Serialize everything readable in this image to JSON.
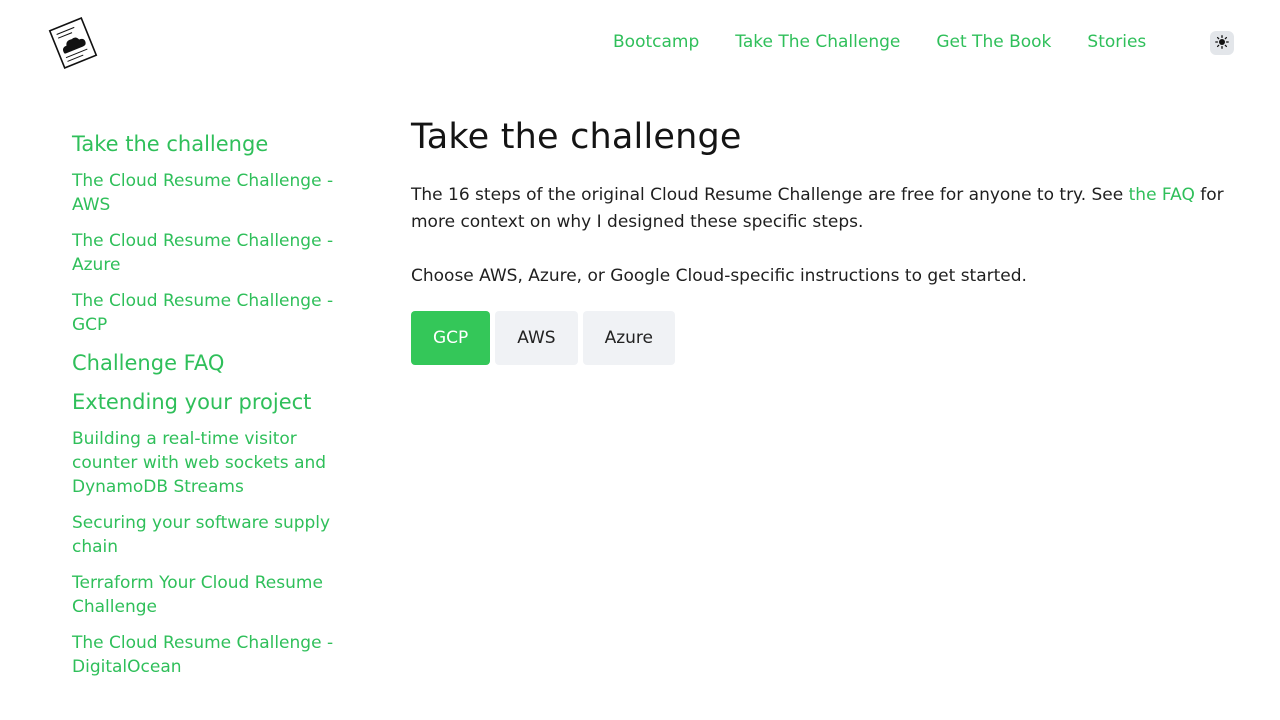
{
  "header": {
    "logo_icon": "cloud-resume-logo-icon",
    "nav": [
      "Bootcamp",
      "Take The Challenge",
      "Get The Book",
      "Stories"
    ],
    "theme_toggle_icon": "sun-icon"
  },
  "sidebar": {
    "sections": [
      {
        "title": "Take the challenge",
        "items": [
          "The Cloud Resume Challenge - AWS",
          "The Cloud Resume Challenge - Azure",
          "The Cloud Resume Challenge - GCP"
        ]
      },
      {
        "title": "Challenge FAQ",
        "items": []
      },
      {
        "title": "Extending your project",
        "items": [
          "Building a real-time visitor counter with web sockets and DynamoDB Streams",
          "Securing your software supply chain",
          "Terraform Your Cloud Resume Challenge",
          "The Cloud Resume Challenge - DigitalOcean"
        ]
      }
    ]
  },
  "main": {
    "title": "Take the challenge",
    "intro_before_link": "The 16 steps of the original Cloud Resume Challenge are free for anyone to try. See ",
    "intro_link": "the FAQ",
    "intro_after_link": " for more context on why I designed these specific steps.",
    "choose_text": "Choose AWS, Azure, or Google Cloud-specific instructions to get started.",
    "tabs": [
      "GCP",
      "AWS",
      "Azure"
    ],
    "active_tab": "GCP"
  },
  "colors": {
    "accent": "#2fbf5a",
    "active_tab": "#34c759",
    "tab_bg": "#f0f2f5"
  }
}
